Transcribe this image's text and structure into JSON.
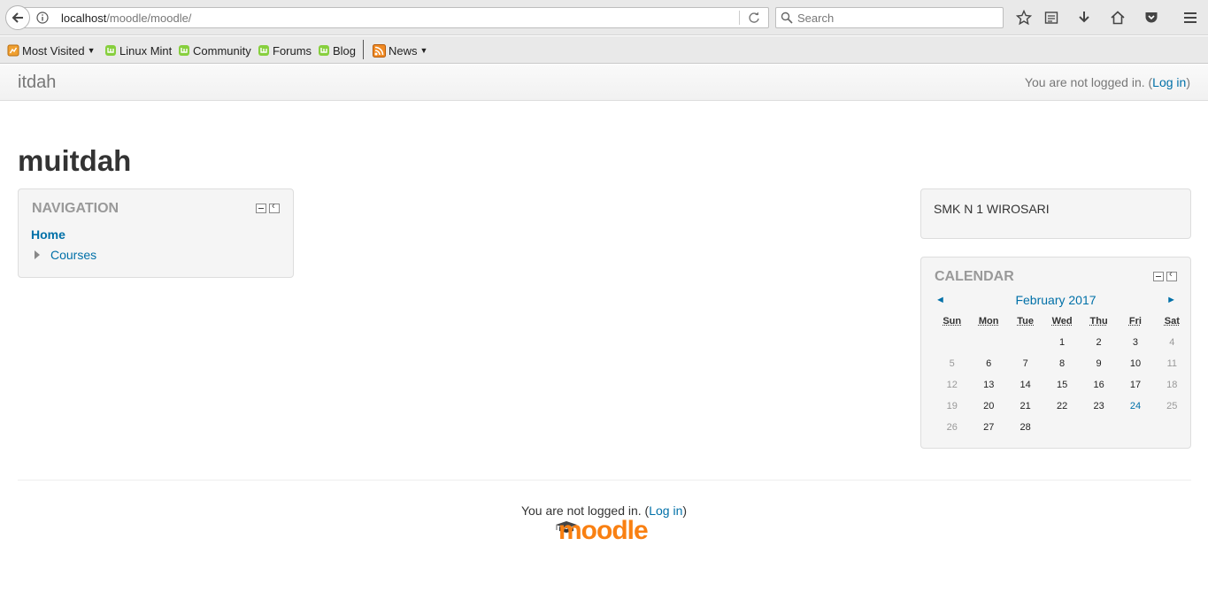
{
  "browser": {
    "url_host": "localhost",
    "url_path": "/moodle/moodle/",
    "search_placeholder": "Search",
    "bookmarks": [
      {
        "label": "Most Visited",
        "icon": "most-visited-icon",
        "dropdown": true
      },
      {
        "label": "Linux Mint",
        "icon": "mint-icon"
      },
      {
        "label": "Community",
        "icon": "mint-icon"
      },
      {
        "label": "Forums",
        "icon": "mint-icon"
      },
      {
        "label": "Blog",
        "icon": "mint-icon"
      },
      {
        "label": "News",
        "icon": "rss-icon",
        "dropdown": true
      }
    ]
  },
  "header": {
    "brand": "itdah",
    "login_prefix": "You are not logged in. (",
    "login_link": "Log in",
    "login_suffix": ")"
  },
  "page": {
    "title": "muitdah"
  },
  "navigation": {
    "title": "NAVIGATION",
    "home": "Home",
    "courses": "Courses"
  },
  "html_block": {
    "text": "SMK N 1 WIROSARI"
  },
  "calendar": {
    "title": "CALENDAR",
    "month": "February 2017",
    "prev": "◄",
    "next": "►",
    "weekdays": [
      "Sun",
      "Mon",
      "Tue",
      "Wed",
      "Thu",
      "Fri",
      "Sat"
    ],
    "weeks": [
      [
        "",
        "",
        "",
        "1",
        "2",
        "3",
        "4"
      ],
      [
        "5",
        "6",
        "7",
        "8",
        "9",
        "10",
        "11"
      ],
      [
        "12",
        "13",
        "14",
        "15",
        "16",
        "17",
        "18"
      ],
      [
        "19",
        "20",
        "21",
        "22",
        "23",
        "24",
        "25"
      ],
      [
        "26",
        "27",
        "28",
        "",
        "",
        "",
        ""
      ]
    ],
    "today": "24"
  },
  "footer": {
    "login_prefix": "You are not logged in. (",
    "login_link": "Log in",
    "login_suffix": ")",
    "logo_text": "moodle"
  },
  "colors": {
    "link": "#0070a8",
    "moodle_orange": "#f98012"
  }
}
